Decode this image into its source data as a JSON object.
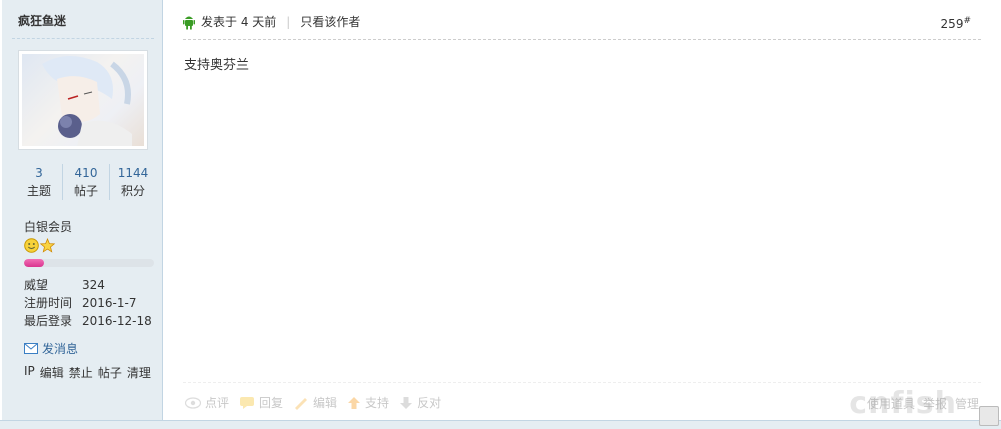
{
  "author": {
    "name": "疯狂鱼迷",
    "stats": [
      {
        "num": "3",
        "label": "主题"
      },
      {
        "num": "410",
        "label": "帖子"
      },
      {
        "num": "1144",
        "label": "积分"
      }
    ],
    "group": "白银会员",
    "level_progress": 0.15,
    "info": [
      {
        "key": "威望",
        "value": "324"
      },
      {
        "key": "注册时间",
        "value": "2016-1-7"
      },
      {
        "key": "最后登录",
        "value": "2016-12-18"
      }
    ],
    "send_message": "发消息",
    "admin_links": [
      "IP",
      "编辑",
      "禁止",
      "帖子",
      "清理"
    ]
  },
  "post": {
    "posted_at": "发表于 4 天前",
    "only_author": "只看该作者",
    "floor": "259",
    "floor_mark": "#",
    "content": "支持奥芬兰",
    "actions": [
      "点评",
      "回复",
      "编辑",
      "支持",
      "反对"
    ],
    "right_actions": [
      "使用道具",
      "举报",
      "管理"
    ]
  },
  "watermark": "cnfish",
  "colors": {
    "link": "#336699",
    "sidebar_bg": "#e5edf2",
    "border": "#c2d5e3",
    "progress": "#e0429e"
  }
}
